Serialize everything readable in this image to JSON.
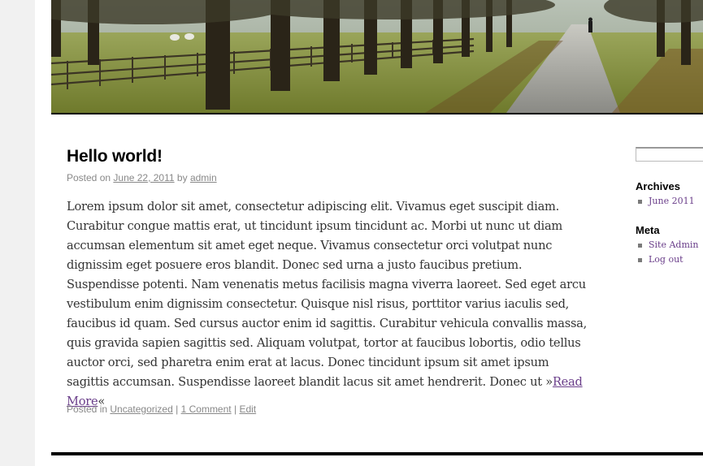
{
  "header": {
    "image_alt": "Tree-lined country path header image"
  },
  "post": {
    "title": "Hello world!",
    "meta": {
      "posted_on": "Posted on",
      "date": "June 22, 2011",
      "by": "by",
      "author": "admin"
    },
    "content": "Lorem ipsum dolor sit amet, consectetur adipiscing elit. Vivamus eget suscipit diam. Curabitur congue mattis erat, ut tincidunt ipsum tincidunt ac. Morbi ut nunc ut diam accumsan elementum sit amet eget neque. Vivamus consectetur orci volutpat nunc dignissim eget posuere eros blandit. Donec sed urna a justo faucibus pretium. Suspendisse potenti. Nam venenatis metus facilisis magna viverra laoreet. Sed eget arcu vestibulum enim dignissim consectetur. Quisque nisl risus, porttitor varius iaculis sed, faucibus id quam. Sed cursus auctor enim id sagittis. Curabitur vehicula convallis massa, quis gravida sapien sagittis sed. Aliquam volutpat, tortor at faucibus lobortis, odio tellus auctor orci, sed pharetra enim erat at lacus. Donec tincidunt ipsum sit amet ipsum sagittis accumsan. Suspendisse laoreet blandit lacus sit amet hendrerit. Donec ut »",
    "read_more": "Read More",
    "read_more_suffix": "«",
    "utility": {
      "posted_in": "Posted in",
      "category": "Uncategorized",
      "separator": "|",
      "comments": "1 Comment",
      "edit": "Edit"
    }
  },
  "sidebar": {
    "search": {
      "value": "",
      "placeholder": ""
    },
    "archives": {
      "title": "Archives",
      "items": [
        {
          "label": "June 2011"
        }
      ]
    },
    "meta": {
      "title": "Meta",
      "items": [
        {
          "label": "Site Admin"
        },
        {
          "label": "Log out"
        }
      ]
    }
  },
  "colors": {
    "link": "#6a3e8a",
    "meta_text": "#888888",
    "body_text": "#333333",
    "page_bg": "#f1f1f1"
  }
}
